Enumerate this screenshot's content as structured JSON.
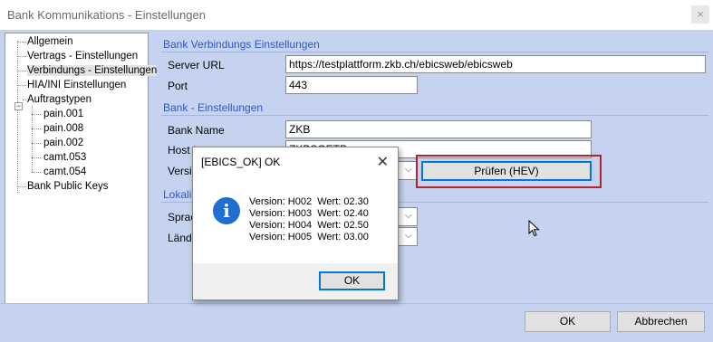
{
  "window": {
    "title": "Bank Kommunikations - Einstellungen",
    "close_glyph": "×"
  },
  "tree": {
    "items": [
      {
        "label": "Allgemein"
      },
      {
        "label": "Vertrags - Einstellungen"
      },
      {
        "label": "Verbindungs - Einstellungen",
        "selected": true
      },
      {
        "label": "HIA/INI Einstellungen"
      },
      {
        "label": "Auftragstypen",
        "expander": "−"
      },
      {
        "label": "pain.001"
      },
      {
        "label": "pain.008"
      },
      {
        "label": "pain.002"
      },
      {
        "label": "camt.053"
      },
      {
        "label": "camt.054"
      },
      {
        "label": "Bank Public Keys"
      }
    ]
  },
  "connection": {
    "section_title": "Bank Verbindungs Einstellungen",
    "server_url_label": "Server URL",
    "server_url_value": "https://testplattform.zkb.ch/ebicsweb/ebicsweb",
    "port_label": "Port",
    "port_value": "443"
  },
  "bank": {
    "section_title": "Bank - Einstellungen",
    "bank_name_label": "Bank Name",
    "bank_name_value": "ZKB",
    "host_id_label": "Host I",
    "host_id_value": "ZKBSOETP",
    "version_label": "Versio",
    "check_button": "Prüfen (HEV)"
  },
  "localisation": {
    "section_title": "Lokalis",
    "language_label": "Sprac",
    "country_label": "Lände"
  },
  "footer": {
    "ok_button": "OK",
    "cancel_button": "Abbrechen"
  },
  "dialog": {
    "title": "[EBICS_OK] OK",
    "close_glyph": "✕",
    "icon_glyph": "i",
    "lines": [
      "Version: H002  Wert: 02.30",
      "Version: H003  Wert: 02.40",
      "Version: H004  Wert: 02.50",
      "Version: H005  Wert: 03.00"
    ],
    "ok_button": "OK"
  }
}
